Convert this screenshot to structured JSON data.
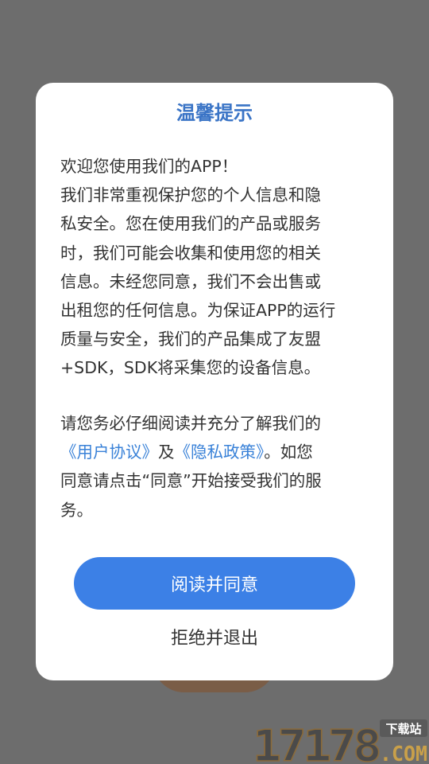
{
  "dialog": {
    "title": "温馨提示",
    "paragraph1_lines": [
      "欢迎您使用我们的APP！",
      "我们非常重视保护您的个人信息和隐",
      "私安全。您在使用我们的产品或服务",
      "时，我们可能会收集和使用您的相关",
      "信息。未经您同意，我们不会出售或",
      "出租您的任何信息。为保证APP的运行",
      "质量与安全，我们的产品集成了友盟",
      "+SDK，SDK将采集您的设备信息。"
    ],
    "paragraph2": {
      "line1": "请您务必仔细阅读并充分了解我们的",
      "user_agreement_link": "《用户协议》",
      "and_text": "及",
      "privacy_policy_link": "《隐私政策》",
      "line2_tail": "。如您",
      "line3": "同意请点击“同意”开始接受我们的服",
      "line4": "务。"
    },
    "agree_label": "阅读并同意",
    "reject_label": "拒绝并退出"
  },
  "watermark": {
    "number": "17178",
    "tag": "下载站",
    "domain": ".COM"
  },
  "colors": {
    "title": "#3a74c6",
    "link": "#3a82d8",
    "primary_button": "#3c80e6",
    "overlay": "#6d6d6d"
  }
}
